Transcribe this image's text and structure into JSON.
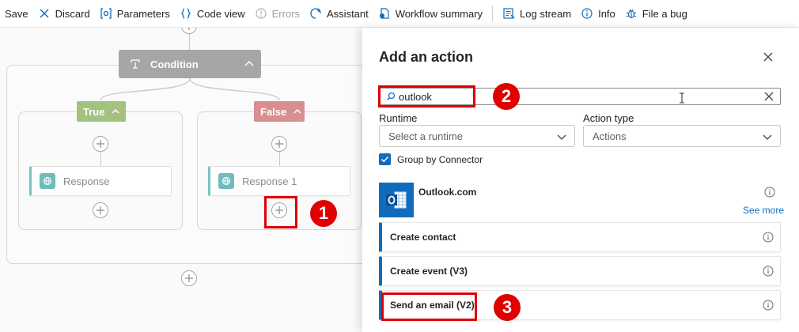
{
  "toolbar": {
    "save": "Save",
    "discard": "Discard",
    "parameters": "Parameters",
    "code_view": "Code view",
    "errors": "Errors",
    "assistant": "Assistant",
    "workflow_summary": "Workflow summary",
    "log_stream": "Log stream",
    "info": "Info",
    "file_bug": "File a bug"
  },
  "canvas": {
    "condition_label": "Condition",
    "true_label": "True",
    "false_label": "False",
    "true_action": "Response",
    "false_action": "Response 1"
  },
  "panel": {
    "title": "Add an action",
    "search_value": "outlook",
    "runtime_label": "Runtime",
    "runtime_placeholder": "Select a runtime",
    "action_type_label": "Action type",
    "action_type_value": "Actions",
    "group_by_connector": "Group by Connector",
    "connector_name": "Outlook.com",
    "see_more": "See more",
    "actions": [
      "Create contact",
      "Create event (V3)",
      "Send an email (V2)"
    ]
  },
  "annotations": {
    "step1": "1",
    "step2": "2",
    "step3": "3"
  },
  "colors": {
    "accent": "#0f6cbd",
    "true_branch": "#a3c27d",
    "false_branch": "#d98e90",
    "condition": "#a6a6a6",
    "highlight": "#e00000"
  }
}
